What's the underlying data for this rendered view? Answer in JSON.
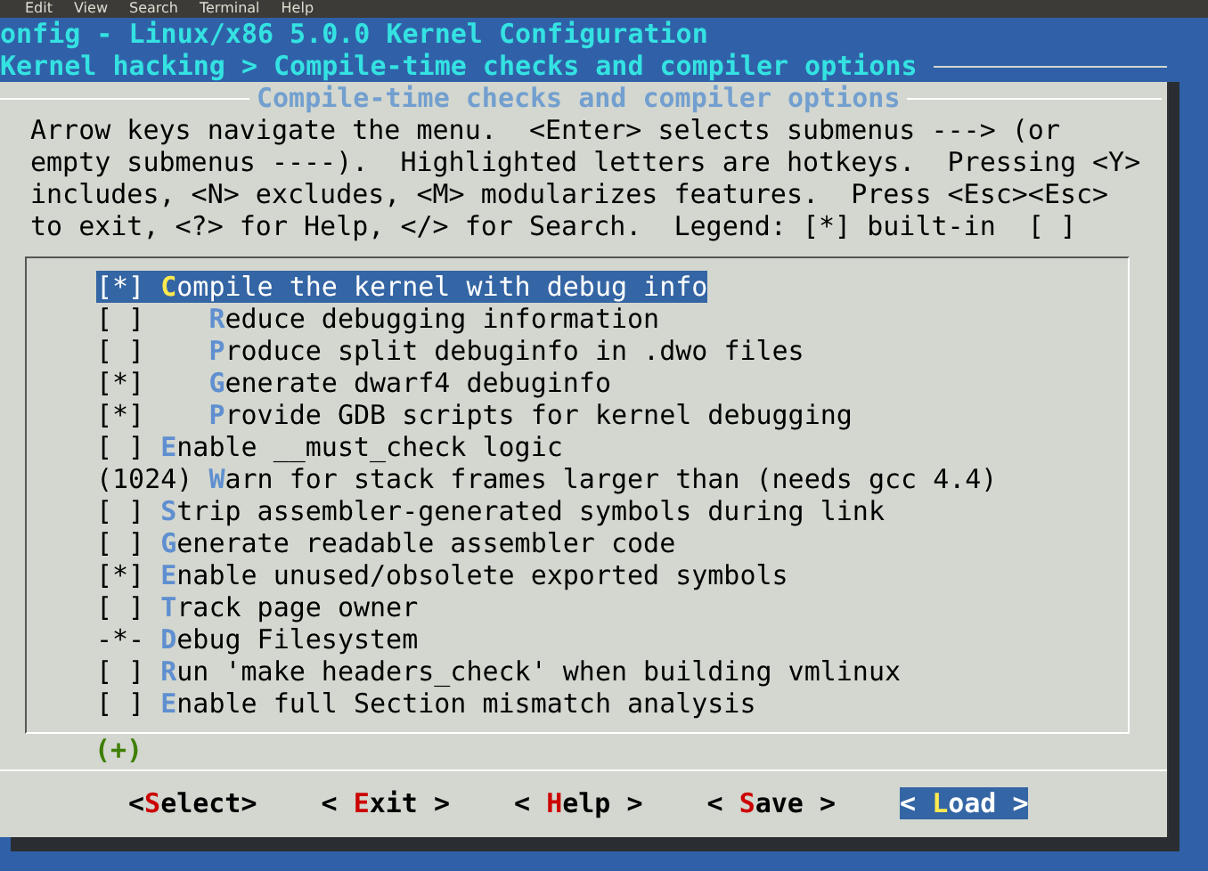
{
  "menu_bar": [
    "Edit",
    "View",
    "Search",
    "Terminal",
    "Help"
  ],
  "title": "onfig - Linux/x86 5.0.0 Kernel Configuration",
  "breadcrumb": "Kernel hacking > Compile-time checks and compiler options",
  "dialog": {
    "title": "Compile-time checks and compiler options",
    "help_text": "Arrow keys navigate the menu.  <Enter> selects submenus ---> (or empty submenus ----).  Highlighted letters are hotkeys.  Pressing <Y> includes, <N> excludes, <M> modularizes features.  Press <Esc><Esc> to exit, <?> for Help, </> for Search.  Legend: [*] built-in  [ ]",
    "items": [
      {
        "prefix": "[*]",
        "label": "Compile the kernel with debug info",
        "selected": true,
        "children": [
          {
            "prefix": "[ ]",
            "label": "Reduce debugging information",
            "selected": false
          },
          {
            "prefix": "[ ]",
            "label": "Produce split debuginfo in .dwo files",
            "selected": false
          },
          {
            "prefix": "[*]",
            "label": "Generate dwarf4 debuginfo",
            "selected": false
          },
          {
            "prefix": "[*]",
            "label": "Provide GDB scripts for kernel debugging",
            "selected": false
          }
        ]
      },
      {
        "prefix": "[ ]",
        "label": "Enable __must_check logic",
        "selected": false
      },
      {
        "prefix": "(1024)",
        "label": "Warn for stack frames larger than (needs gcc 4.4)",
        "selected": false
      },
      {
        "prefix": "[ ]",
        "label": "Strip assembler-generated symbols during link",
        "selected": false
      },
      {
        "prefix": "[ ]",
        "label": "Generate readable assembler code",
        "selected": false
      },
      {
        "prefix": "[*]",
        "label": "Enable unused/obsolete exported symbols",
        "selected": false
      },
      {
        "prefix": "[ ]",
        "label": "Track page owner",
        "selected": false
      },
      {
        "prefix": "-*-",
        "label": "Debug Filesystem",
        "selected": false
      },
      {
        "prefix": "[ ]",
        "label": "Run 'make headers_check' when building vmlinux",
        "selected": false
      },
      {
        "prefix": "[ ]",
        "label": "Enable full Section mismatch analysis",
        "selected": false
      }
    ],
    "more_indicator": "(+)",
    "buttons": [
      {
        "label": "<Select>",
        "selected": false
      },
      {
        "label": "< Exit >",
        "selected": false
      },
      {
        "label": "< Help >",
        "selected": false
      },
      {
        "label": "< Save >",
        "selected": false
      },
      {
        "label": "< Load >",
        "selected": true
      }
    ]
  }
}
